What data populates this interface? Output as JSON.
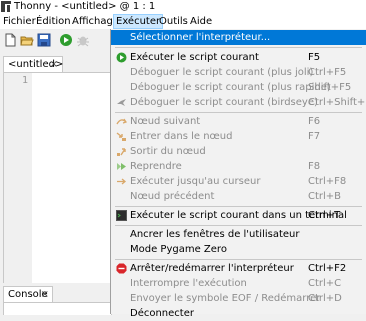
{
  "window": {
    "title": "Thonny  -  <untitled>  @  1 : 1"
  },
  "menubar": {
    "items": [
      "Fichier",
      "Édition",
      "Affichage",
      "Exécuter",
      "Outils",
      "Aide"
    ]
  },
  "toolbar": {
    "buttons": [
      "new-file-icon",
      "open-folder-icon",
      "save-icon",
      "run-icon",
      "debug-icon"
    ]
  },
  "editor": {
    "tab_label": "<untitled>",
    "tab_close": "×",
    "line_number": "1"
  },
  "console": {
    "tab_label": "Console",
    "tab_close": "×"
  },
  "colors": {
    "highlight": "#0078d7",
    "disabled_text": "#8d8d8d",
    "run_green": "#2e9d2e",
    "stop_red": "#d9262b"
  },
  "run_menu": {
    "select_interpreter": {
      "label": "Sélectionner l'interpréteur..."
    },
    "run_current": {
      "label": "Exécuter le script courant",
      "shortcut": "F5",
      "icon": "run-icon"
    },
    "debug_nicer": {
      "label": "Déboguer le script courant (plus joli)",
      "shortcut": "Ctrl+F5"
    },
    "debug_faster": {
      "label": "Déboguer le script courant (plus rapide)",
      "shortcut": "Shift+F5"
    },
    "debug_birdseye": {
      "label": "Déboguer le script courant (birdseye)",
      "shortcut": "Ctrl+Shift+B",
      "icon": "birdseye-icon"
    },
    "step_over": {
      "label": "Nœud suivant",
      "shortcut": "F6",
      "icon": "step-over-icon"
    },
    "step_into": {
      "label": "Entrer dans le nœud",
      "shortcut": "F7",
      "icon": "step-into-icon"
    },
    "step_out": {
      "label": "Sortir du nœud",
      "icon": "step-out-icon"
    },
    "resume": {
      "label": "Reprendre",
      "shortcut": "F8",
      "icon": "resume-icon"
    },
    "run_to_cursor": {
      "label": "Exécuter jusqu'au curseur",
      "shortcut": "Ctrl+F8"
    },
    "step_back": {
      "label": "Nœud précédent",
      "shortcut": "Ctrl+B"
    },
    "run_in_terminal": {
      "label": "Exécuter le script courant dans un terminal",
      "shortcut": "Ctrl+T",
      "icon": "terminal-icon"
    },
    "dock_windows": {
      "label": "Ancrer les fenêtres de l'utilisateur"
    },
    "pygame_mode": {
      "label": "Mode Pygame Zero"
    },
    "stop_restart": {
      "label": "Arrêter/redémarrer l'interpréteur",
      "shortcut": "Ctrl+F2",
      "icon": "stop-icon"
    },
    "interrupt": {
      "label": "Interrompre l'exécution",
      "shortcut": "Ctrl+C"
    },
    "send_eof": {
      "label": "Envoyer le symbole EOF / Redémarrer",
      "shortcut": "Ctrl+D"
    },
    "disconnect": {
      "label": "Déconnecter"
    }
  }
}
